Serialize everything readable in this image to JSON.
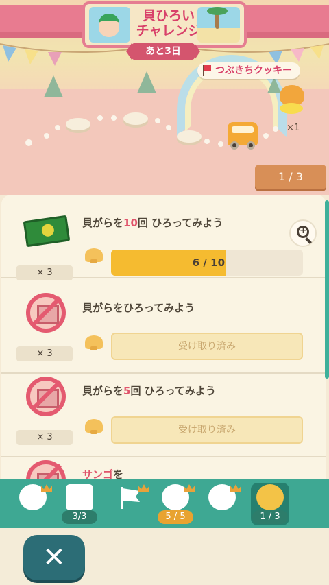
{
  "event": {
    "title_line1": "貝ひろい",
    "title_line2": "チャレンジ",
    "days_left": "あと3日",
    "reward_label": "つぶきちクッキー",
    "reward_count": "×1",
    "stage_progress": "1 / 3"
  },
  "challenges": [
    {
      "title_prefix": "貝がらを",
      "title_number": "10",
      "title_suffix": "回 ひろってみよう",
      "reward_qty": "× 3",
      "progress_text": "6 / 10",
      "progress_fraction": 0.6,
      "status": "in_progress"
    },
    {
      "title_prefix": "貝がらをひろってみよう",
      "title_number": "",
      "title_suffix": "",
      "reward_qty": "× 3",
      "claimed_label": "受け取り済み",
      "status": "claimed"
    },
    {
      "title_prefix": "貝がらを",
      "title_number": "5",
      "title_suffix": "回 ひろってみよう",
      "reward_qty": "× 3",
      "claimed_label": "受け取り済み",
      "status": "claimed"
    },
    {
      "title_prefix": "",
      "title_number": "サンゴ",
      "title_suffix": "を",
      "status": "partial"
    }
  ],
  "nav": {
    "tabs": [
      {
        "icon": "villager-icon",
        "badge": ""
      },
      {
        "icon": "calendar-icon",
        "badge": "3/3"
      },
      {
        "icon": "flag-icon",
        "badge": ""
      },
      {
        "icon": "timer-icon",
        "badge": "5 / 5"
      },
      {
        "icon": "timer-icon",
        "badge": ""
      },
      {
        "icon": "timer-icon",
        "badge": "1 / 3"
      }
    ]
  },
  "close_label": "✕",
  "colors": {
    "accent": "#3ea893",
    "pink": "#e87b90",
    "progress": "#f5bb30"
  }
}
